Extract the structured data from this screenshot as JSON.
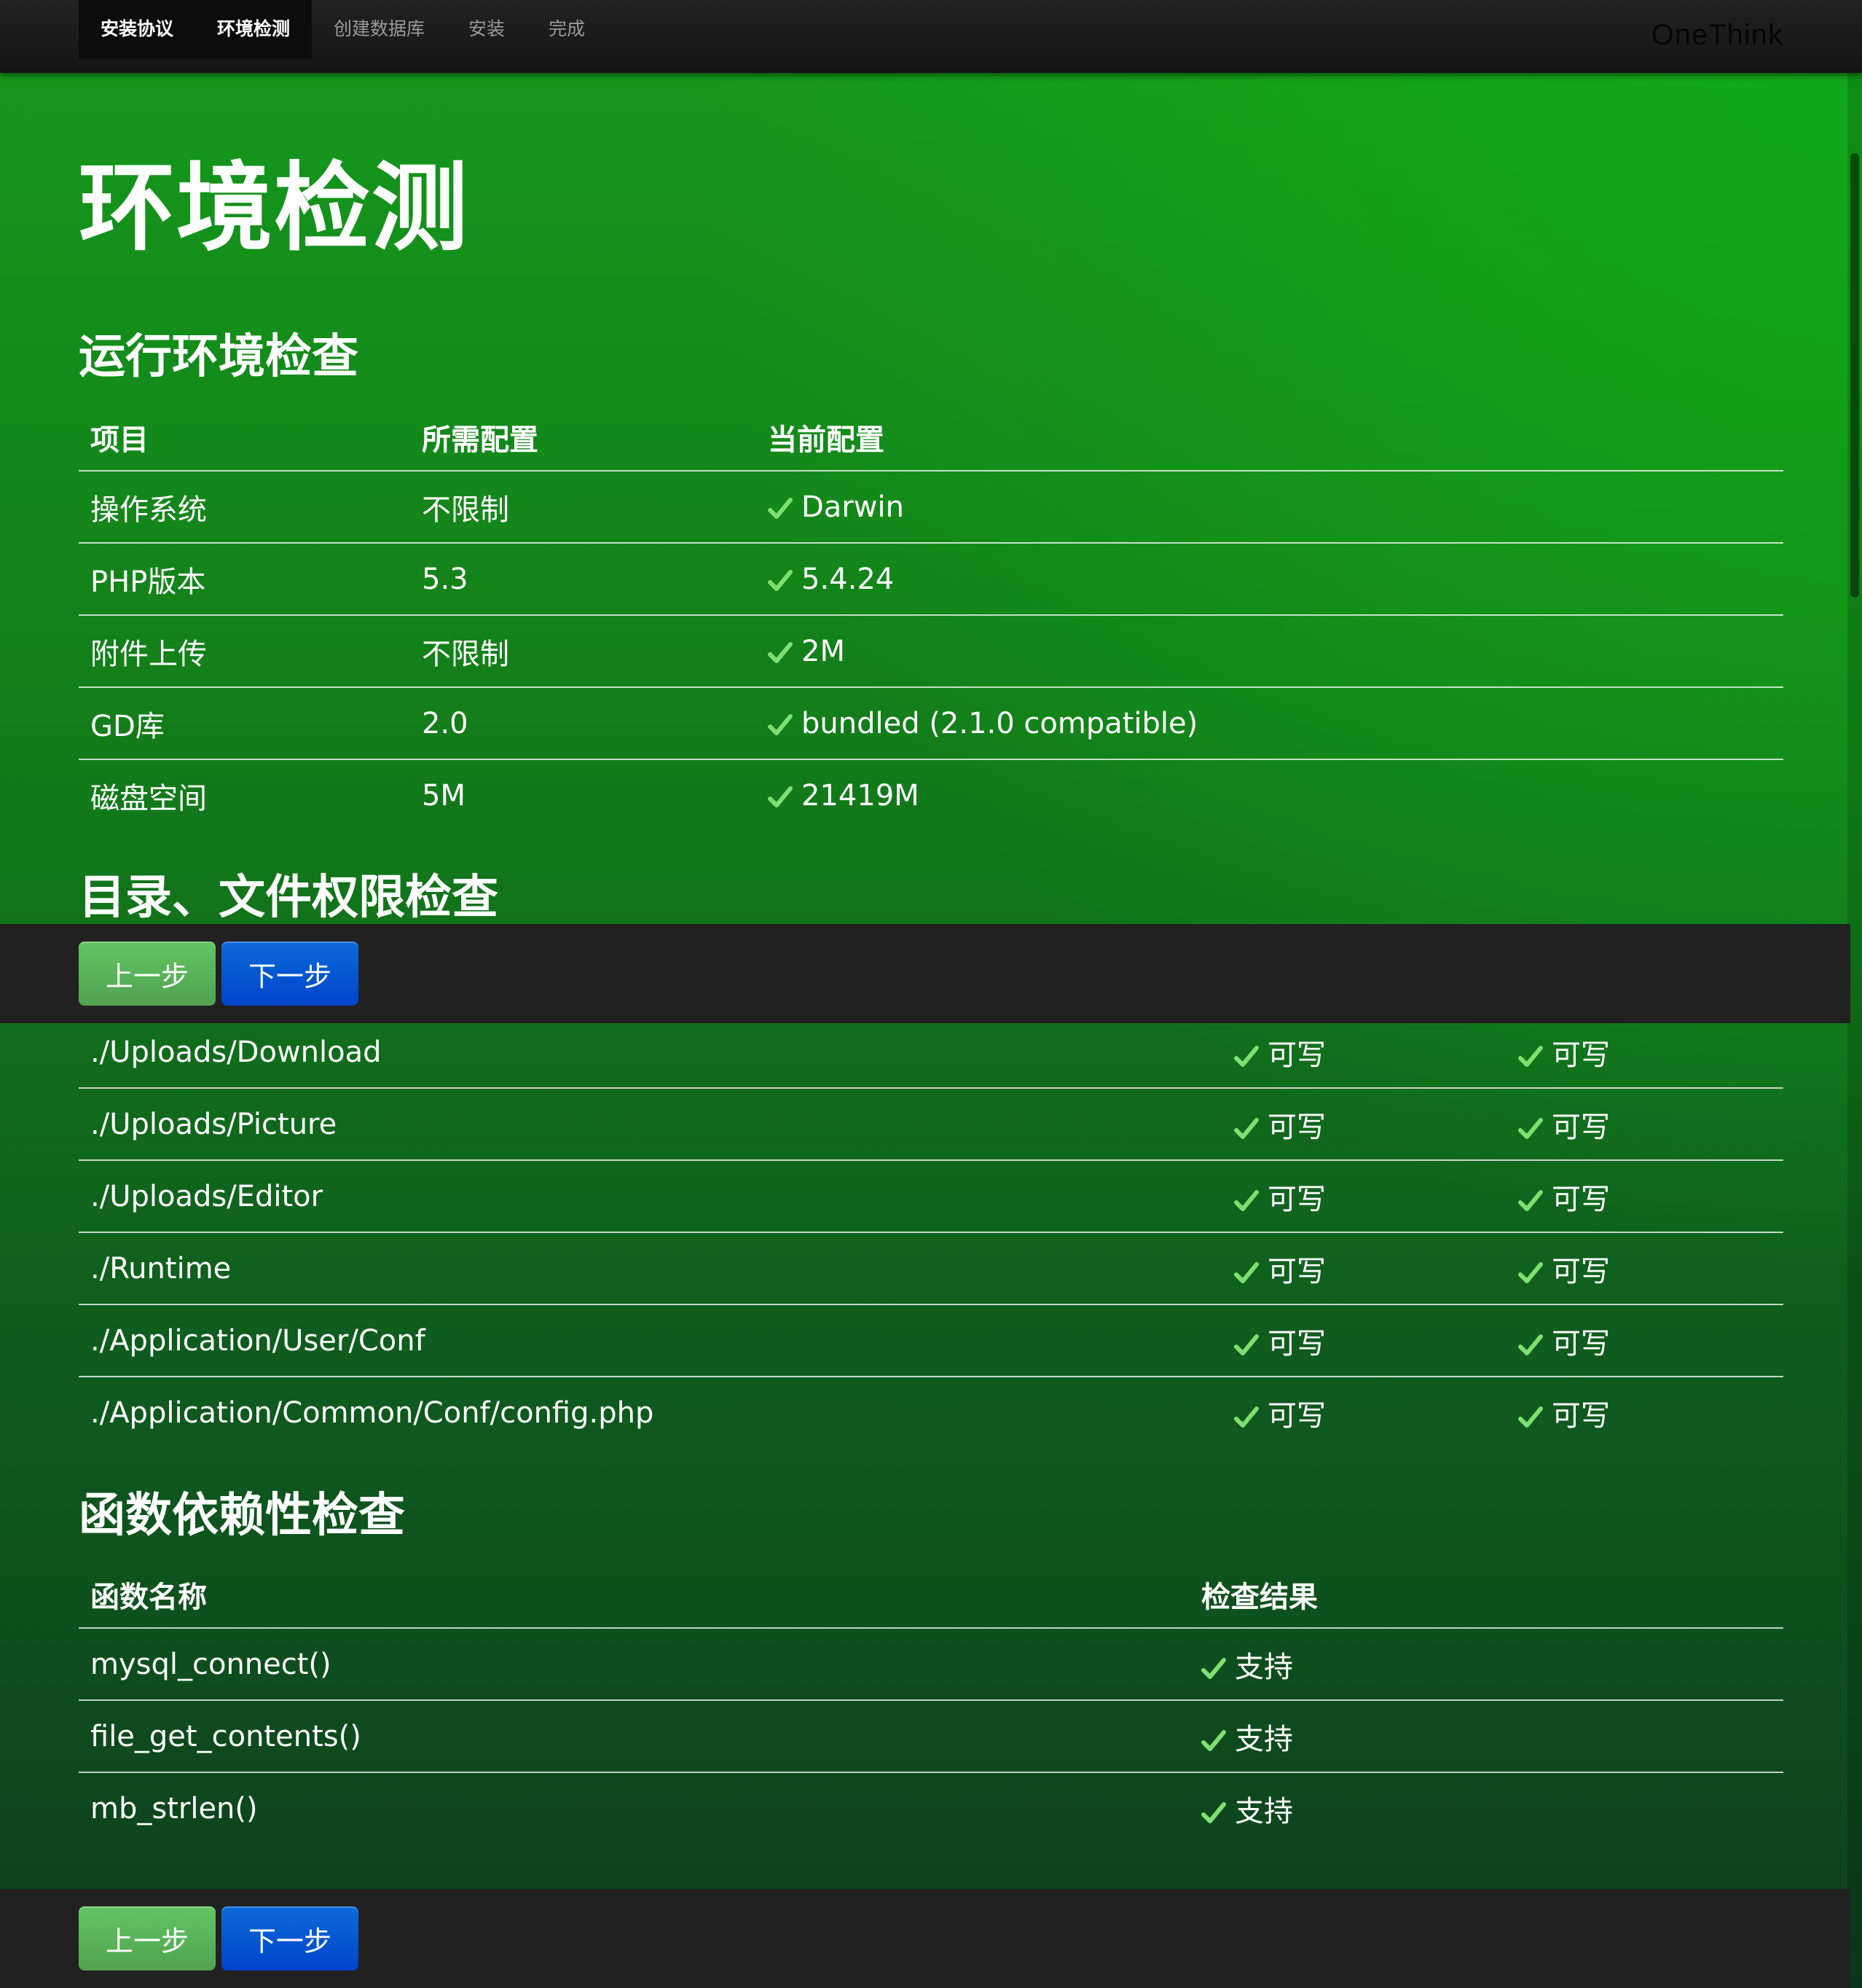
{
  "nav": {
    "items": [
      {
        "label": "安装协议"
      },
      {
        "label": "环境检测"
      },
      {
        "label": "创建数据库"
      },
      {
        "label": "安装"
      },
      {
        "label": "完成"
      }
    ],
    "active_index": 1,
    "brand": "OneThink"
  },
  "page_title": "环境检测",
  "env_check": {
    "heading": "运行环境检查",
    "columns": [
      "项目",
      "所需配置",
      "当前配置"
    ],
    "rows": [
      {
        "item": "操作系统",
        "required": "不限制",
        "current": "Darwin"
      },
      {
        "item": "PHP版本",
        "required": "5.3",
        "current": "5.4.24"
      },
      {
        "item": "附件上传",
        "required": "不限制",
        "current": "2M"
      },
      {
        "item": "GD库",
        "required": "2.0",
        "current": "bundled (2.1.0 compatible)"
      },
      {
        "item": "磁盘空间",
        "required": "5M",
        "current": "21419M"
      }
    ]
  },
  "dir_check": {
    "heading": "目录、文件权限检查",
    "rows": [
      {
        "path": "./Uploads/Download",
        "required": "可写",
        "current": "可写"
      },
      {
        "path": "./Uploads/Picture",
        "required": "可写",
        "current": "可写"
      },
      {
        "path": "./Uploads/Editor",
        "required": "可写",
        "current": "可写"
      },
      {
        "path": "./Runtime",
        "required": "可写",
        "current": "可写"
      },
      {
        "path": "./Application/User/Conf",
        "required": "可写",
        "current": "可写"
      },
      {
        "path": "./Application/Common/Conf/config.php",
        "required": "可写",
        "current": "可写"
      }
    ]
  },
  "func_check": {
    "heading": "函数依赖性检查",
    "columns": [
      "函数名称",
      "检查结果"
    ],
    "rows": [
      {
        "name": "mysql_connect()",
        "result": "支持"
      },
      {
        "name": "file_get_contents()",
        "result": "支持"
      },
      {
        "name": "mb_strlen()",
        "result": "支持"
      }
    ]
  },
  "actions": {
    "prev_label": "上一步",
    "next_label": "下一步"
  },
  "colors": {
    "check": "#7ee070",
    "header_bg": "#1b1b1b",
    "prev_button": "#5bb75b",
    "next_button": "#0055dd"
  }
}
